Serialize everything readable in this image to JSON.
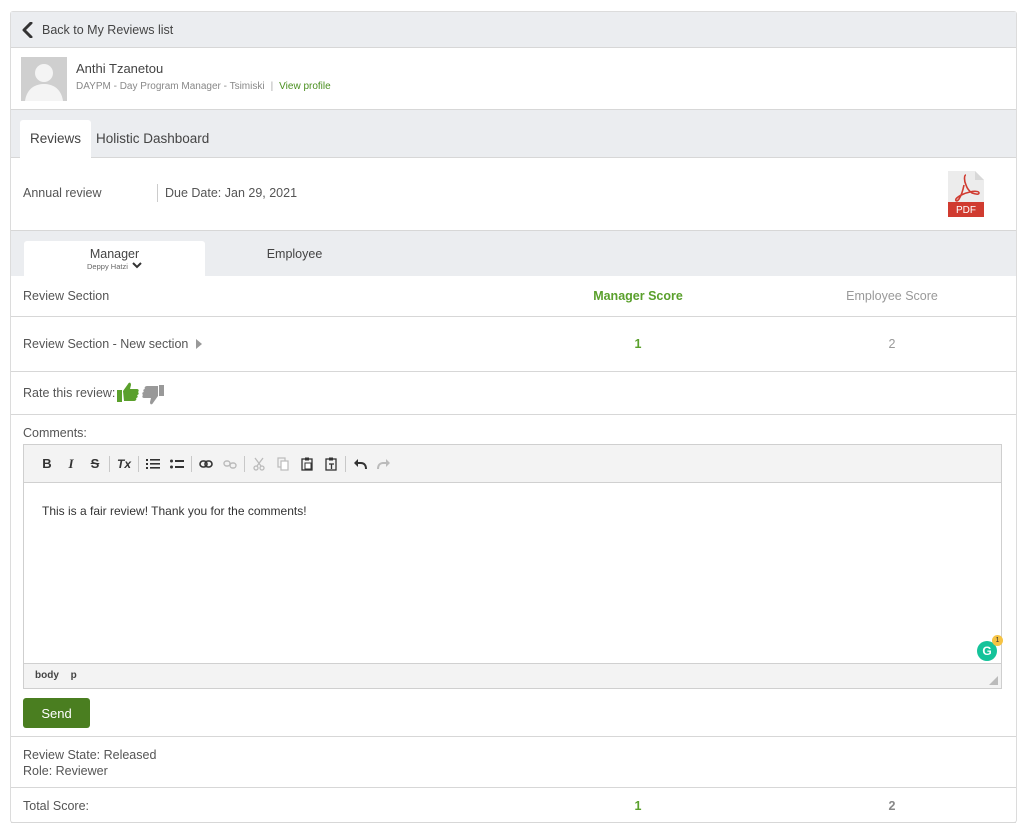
{
  "nav": {
    "back_label": "Back to My Reviews list"
  },
  "profile": {
    "name": "Anthi Tzanetou",
    "subtitle": "DAYPM - Day Program Manager - Tsimiski",
    "separator": "|",
    "view_profile": "View profile"
  },
  "main_tabs": [
    {
      "label": "Reviews",
      "active": true
    },
    {
      "label": "Holistic Dashboard",
      "active": false
    }
  ],
  "review": {
    "type": "Annual review",
    "due_date": "Due Date: Jan 29, 2021",
    "pdf_label": "PDF"
  },
  "role_tabs": {
    "manager": {
      "label": "Manager",
      "sub": "Deppy Hatzi"
    },
    "employee": {
      "label": "Employee"
    }
  },
  "table": {
    "headers": {
      "section": "Review Section",
      "manager": "Manager Score",
      "employee": "Employee Score"
    },
    "rows": [
      {
        "section": "Review Section - New section",
        "manager": "1",
        "employee": "2"
      }
    ]
  },
  "rate": {
    "label": "Rate this review:"
  },
  "comments": {
    "label": "Comments:",
    "text": "This is a fair review! Thank you for the comments!",
    "path": [
      "body",
      "p"
    ],
    "grammarly_count": "1",
    "grammarly_letter": "G"
  },
  "toolbar": {
    "bold": "B",
    "italic": "I",
    "strike": "S",
    "remove_format": "Tx"
  },
  "send_label": "Send",
  "state": {
    "review_state": "Review State: Released",
    "role": "Role: Reviewer"
  },
  "total": {
    "label": "Total Score:",
    "manager": "1",
    "employee": "2"
  },
  "colors": {
    "accent_green": "#5aa02c",
    "button_green": "#4a7e20",
    "pdf_red": "#c9302c"
  }
}
